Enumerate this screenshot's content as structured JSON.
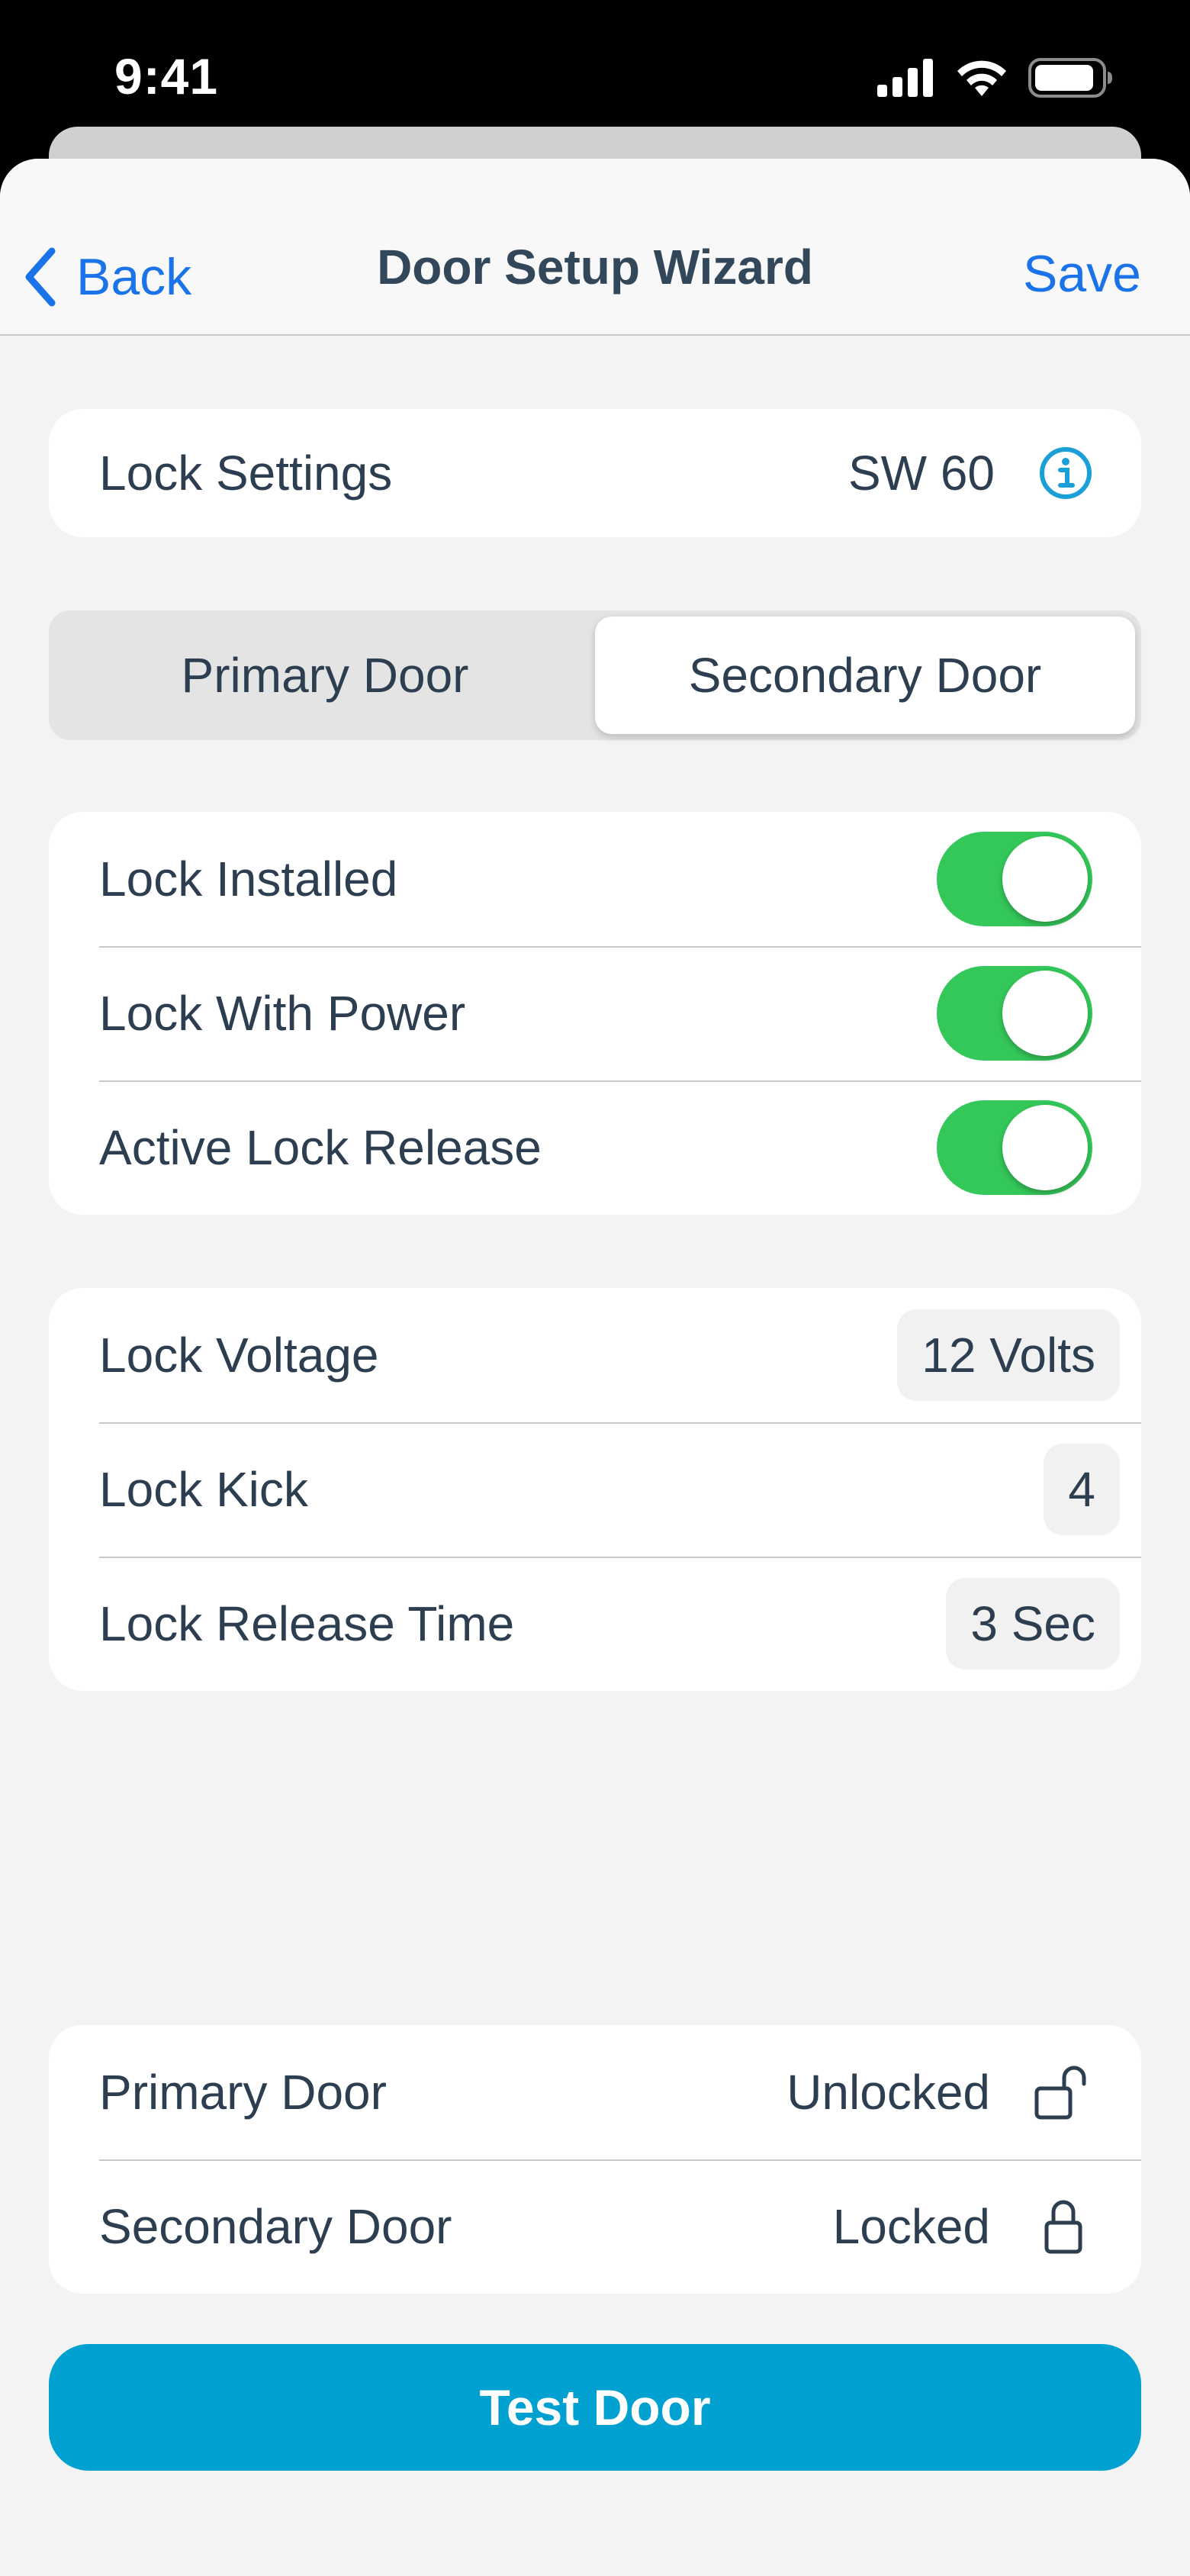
{
  "status_bar": {
    "time": "9:41"
  },
  "nav": {
    "back_label": "Back",
    "title": "Door Setup Wizard",
    "save_label": "Save"
  },
  "lock_settings": {
    "label": "Lock Settings",
    "value": "SW 60"
  },
  "segments": [
    {
      "label": "Primary Door"
    },
    {
      "label": "Secondary Door"
    }
  ],
  "selected_segment": "Secondary Door",
  "toggles": [
    {
      "label": "Lock Installed",
      "on": true
    },
    {
      "label": "Lock With Power",
      "on": true
    },
    {
      "label": "Active Lock Release",
      "on": true
    }
  ],
  "params": [
    {
      "label": "Lock Voltage",
      "value": "12 Volts"
    },
    {
      "label": "Lock Kick",
      "value": "4"
    },
    {
      "label": "Lock Release Time",
      "value": "3 Sec"
    }
  ],
  "door_status": [
    {
      "label": "Primary Door",
      "value": "Unlocked",
      "icon": "unlocked-padlock-icon"
    },
    {
      "label": "Secondary Door",
      "value": "Locked",
      "icon": "locked-padlock-icon"
    }
  ],
  "test_button": {
    "label": "Test Door"
  },
  "colors": {
    "accent": "#1a73e8",
    "toggle_on": "#34c759",
    "primary_button": "#00a0d1"
  }
}
